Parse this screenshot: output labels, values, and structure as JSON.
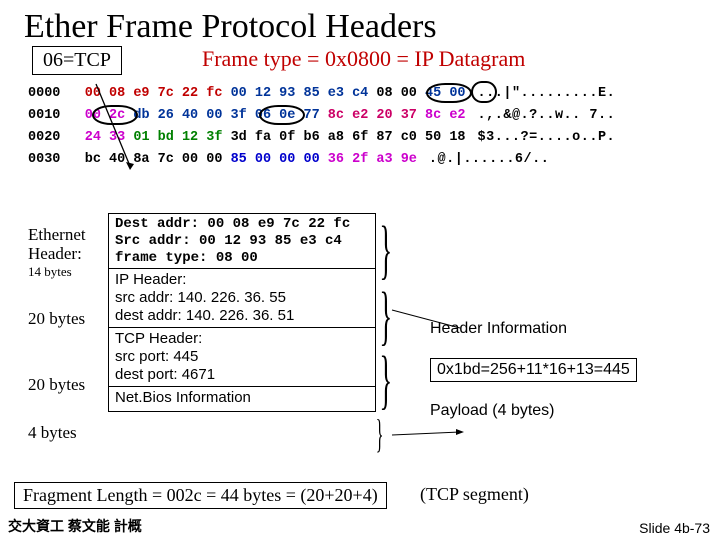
{
  "title": "Ether Frame Protocol Headers",
  "tcp_label": "06=TCP",
  "frame_type": "Frame type = 0x0800 = IP Datagram",
  "hex": {
    "offsets": [
      "0000",
      "0010",
      "0020",
      "0030"
    ],
    "rows": [
      {
        "da": "00 08 e9 7c 22 fc",
        "sa_a": "00 12 93 85 e3 c4",
        "ft": "08 00",
        "ip_a": "45 00",
        "ascii": "...|\".........E."
      },
      {
        "len": "00 2c",
        "ip_b": "db 26 40 00 3f 06 0e 77",
        "ipsrc": "8c e2 20 37",
        "ipdst_a": "8c e2",
        "ascii": ".,.&@.?..w.. 7.."
      },
      {
        "ipdst_b": "24 33",
        "port": "01 bd 12 3f",
        "tcp": "3d fa 0f b6 a8 6f 87 c0 50 18",
        "ascii": "$3...?=....o..P."
      },
      {
        "tcp_b": "bc 40 8a 7c 00 00",
        "nb": "85 00 00 00",
        "pay": "36 2f a3 9e",
        "ascii": ".@.|......6/.."
      }
    ]
  },
  "labels": {
    "eth": "Ethernet Header:",
    "eth_sub": "14 bytes",
    "b20": "20 bytes",
    "b4": "4 bytes"
  },
  "fields": {
    "eth": {
      "dest": "Dest addr:  00 08 e9 7c 22 fc",
      "src": "Src addr:   00 12 93 85 e3 c4",
      "ft": "frame type: 08 00"
    },
    "ip": {
      "hdr": "IP Header:",
      "src": "src addr:   140. 226. 36. 55",
      "dst": "dest addr: 140. 226. 36. 51"
    },
    "tcp": {
      "hdr": "TCP Header:",
      "src": "src port:   445",
      "dst": "dest port: 4671"
    },
    "nb": "Net.Bios Information"
  },
  "right": {
    "hdr_info": "Header Information",
    "hex_calc": "0x1bd=256+11*16+13=445",
    "payload": "Payload (4 bytes)"
  },
  "fraglen": "Fragment Length = 002c = 44 bytes = (20+20+4)",
  "tcpseg": "(TCP segment)",
  "footer_left": "交大資工 蔡文能 計概",
  "footer_right": "Slide 4b-73"
}
